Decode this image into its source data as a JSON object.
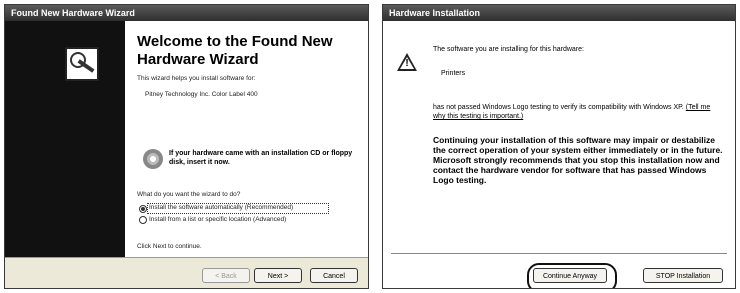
{
  "wizard": {
    "title": "Found New Hardware Wizard",
    "heading": "Welcome to the Found New Hardware Wizard",
    "intro": "This wizard helps you install software for:",
    "device": "Pitney Technology Inc. Color Label 400",
    "cd_note": "If your hardware came with an installation CD or floppy disk, insert it now.",
    "question": "What do you want the wizard to do?",
    "options": [
      {
        "label": "Install the software automatically (Recommended)",
        "selected": true
      },
      {
        "label": "Install from a list or specific location (Advanced)",
        "selected": false
      }
    ],
    "continue_text": "Click Next to continue.",
    "buttons": {
      "back": "< Back",
      "next": "Next >",
      "cancel": "Cancel"
    }
  },
  "hardware_install": {
    "title": "Hardware Installation",
    "intro": "The software you are installing for this hardware:",
    "device": "Printers",
    "logo_text": "has not passed Windows Logo testing to verify its compatibility with Windows XP.",
    "logo_link": "(Tell me why this testing is important.)",
    "warning": "Continuing your installation of this software may impair or destabilize the correct operation of your system either immediately or in the future. Microsoft strongly recommends that you stop this installation now and contact the hardware vendor for software that has passed Windows Logo testing.",
    "buttons": {
      "continue": "Continue Anyway",
      "stop": "STOP Installation"
    }
  },
  "colors": {
    "titlebar": "#3a3a3a",
    "sidebar": "#111111",
    "dialog_bg": "#ece9d8"
  },
  "icons": [
    "wizard-icon",
    "cd-icon",
    "warning-icon"
  ]
}
